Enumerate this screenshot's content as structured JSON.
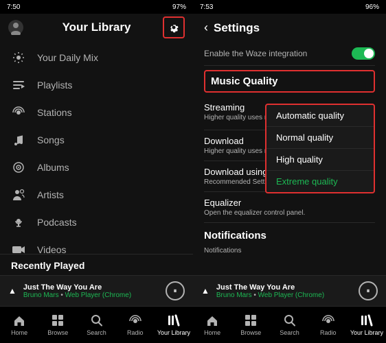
{
  "left": {
    "status_bar": {
      "time": "7:50",
      "battery": "97%",
      "signal": "●●●"
    },
    "header_title": "Your Library",
    "nav_items": [
      {
        "id": "daily-mix",
        "label": "Your Daily Mix",
        "icon": "☀"
      },
      {
        "id": "playlists",
        "label": "Playlists",
        "icon": "♪"
      },
      {
        "id": "stations",
        "label": "Stations",
        "icon": "📻"
      },
      {
        "id": "songs",
        "label": "Songs",
        "icon": "♫"
      },
      {
        "id": "albums",
        "label": "Albums",
        "icon": "▣"
      },
      {
        "id": "artists",
        "label": "Artists",
        "icon": "👤"
      },
      {
        "id": "podcasts",
        "label": "Podcasts",
        "icon": "🎙"
      },
      {
        "id": "videos",
        "label": "Videos",
        "icon": "▶"
      }
    ],
    "recently_played_label": "Recently Played",
    "now_playing": {
      "title": "Just The Way You Are",
      "artist": "Bruno Mars",
      "source": "Web Player (Chrome)"
    },
    "bottom_nav": [
      {
        "id": "home",
        "label": "Home",
        "icon": "⌂",
        "active": false
      },
      {
        "id": "browse",
        "label": "Browse",
        "icon": "⊞",
        "active": false
      },
      {
        "id": "search",
        "label": "Search",
        "icon": "🔍",
        "active": false
      },
      {
        "id": "radio",
        "label": "Radio",
        "icon": "📡",
        "active": false
      },
      {
        "id": "library",
        "label": "Your Library",
        "icon": "≡",
        "active": true
      }
    ]
  },
  "right": {
    "status_bar": {
      "time": "7:53",
      "battery": "96%"
    },
    "header_title": "Settings",
    "waze_label": "Enable the Waze integration",
    "music_quality_label": "Music Quality",
    "streaming_label": "Streaming",
    "streaming_sub": "Higher quality uses more data.",
    "streaming_value": "Extreme quality",
    "download_label": "Download",
    "download_sub": "Higher quality uses more disk space.",
    "download_using_label": "Download using c",
    "download_using_sub": "Recommended Setti",
    "quality_options": [
      {
        "id": "automatic",
        "label": "Automatic quality",
        "selected": false
      },
      {
        "id": "normal",
        "label": "Normal quality",
        "selected": false
      },
      {
        "id": "high",
        "label": "High quality",
        "selected": false
      },
      {
        "id": "extreme",
        "label": "Extreme quality",
        "selected": true
      }
    ],
    "equalizer_label": "Equalizer",
    "equalizer_sub": "Open the equalizer control panel.",
    "notifications_label": "Notifications",
    "notifications_sub": "Notifications",
    "now_playing": {
      "title": "Just The Way You Are",
      "artist": "Bruno Mars",
      "source": "Web Player (Chrome)"
    },
    "bottom_nav": [
      {
        "id": "home",
        "label": "Home",
        "icon": "⌂",
        "active": false
      },
      {
        "id": "browse",
        "label": "Browse",
        "icon": "⊞",
        "active": false
      },
      {
        "id": "search",
        "label": "Search",
        "icon": "🔍",
        "active": false
      },
      {
        "id": "radio",
        "label": "Radio",
        "icon": "📡",
        "active": false
      },
      {
        "id": "library",
        "label": "Your Library",
        "icon": "≡",
        "active": true
      }
    ]
  }
}
